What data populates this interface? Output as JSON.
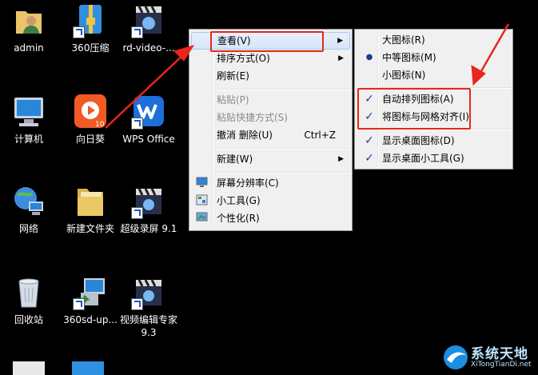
{
  "desktop": {
    "icons": [
      {
        "label": "admin"
      },
      {
        "label": "360压缩"
      },
      {
        "label": "rd-video-..."
      },
      {
        "label": "计算机"
      },
      {
        "label": "向日葵"
      },
      {
        "label": "WPS Office"
      },
      {
        "label": "网络"
      },
      {
        "label": "新建文件夹"
      },
      {
        "label": "超级录屏 9.1"
      },
      {
        "label": "回收站"
      },
      {
        "label": "360sd-up..."
      },
      {
        "label": "视频编辑专家 9.3"
      }
    ],
    "sunlogin_badge": "10",
    "sunlogin_color": "#f15a24",
    "wps_color": "#1e6fd9"
  },
  "context_menu": {
    "items": [
      {
        "label": "查看(V)"
      },
      {
        "label": "排序方式(O)"
      },
      {
        "label": "刷新(E)"
      },
      {
        "label": "粘贴(P)"
      },
      {
        "label": "粘贴快捷方式(S)"
      },
      {
        "label": "撤消 删除(U)",
        "shortcut": "Ctrl+Z"
      },
      {
        "label": "新建(W)"
      },
      {
        "label": "屏幕分辨率(C)"
      },
      {
        "label": "小工具(G)"
      },
      {
        "label": "个性化(R)"
      }
    ]
  },
  "view_submenu": {
    "items": [
      {
        "label": "大图标(R)"
      },
      {
        "label": "中等图标(M)",
        "selected": true
      },
      {
        "label": "小图标(N)"
      },
      {
        "label": "自动排列图标(A)",
        "checked": true
      },
      {
        "label": "将图标与网格对齐(I)",
        "checked": true
      },
      {
        "label": "显示桌面图标(D)",
        "checked": true
      },
      {
        "label": "显示桌面小工具(G)",
        "checked": true
      }
    ]
  },
  "watermark": {
    "title": "系统天地",
    "url": "XiTongTianDi.net"
  },
  "annotation_color": "#e8261b"
}
